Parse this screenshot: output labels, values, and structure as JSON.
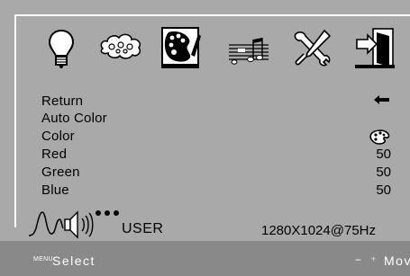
{
  "osd": {
    "tabs": [
      {
        "icon": "lightbulb-icon"
      },
      {
        "icon": "brightness-cloud-icon"
      },
      {
        "icon": "color-palette-icon",
        "selected": true
      },
      {
        "icon": "audio-notes-icon"
      },
      {
        "icon": "tools-icon"
      },
      {
        "icon": "exit-icon"
      }
    ],
    "menu": [
      {
        "label": "Return",
        "value": ""
      },
      {
        "label": "Auto Color",
        "value": ""
      },
      {
        "label": "Color",
        "value": ""
      },
      {
        "label": "Red",
        "value": "50"
      },
      {
        "label": "Green",
        "value": "50"
      },
      {
        "label": "Blue",
        "value": "50"
      }
    ],
    "mode_label": "USER",
    "resolution": "1280X1024@75Hz",
    "footer": {
      "menu_key": "MENU",
      "select_label": "Select",
      "minus_key": "−",
      "plus_key": "+",
      "move_label": "Mov"
    }
  },
  "colors": {
    "background": "#a9a9a9",
    "bottom_bar": "#898989",
    "text": "#000000",
    "footer_text": "#ffffff",
    "selected_tab": "#ffffff"
  }
}
